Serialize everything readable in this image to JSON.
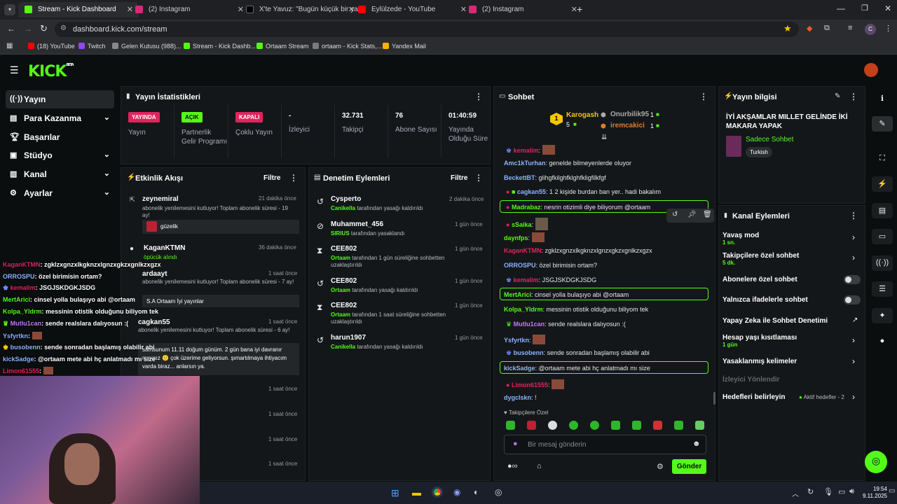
{
  "browser": {
    "tabs": [
      {
        "label": "Stream - Kick Dashboard",
        "color": "#53fc18"
      },
      {
        "label": "(2) Instagram",
        "color": "#d62976"
      },
      {
        "label": "X'te Yavuz: \"Bugün küçük bir ya",
        "color": "#111111"
      },
      {
        "label": "Eylülzede - YouTube",
        "color": "#ff0000"
      },
      {
        "label": "(2) Instagram",
        "color": "#d62976"
      }
    ],
    "url": "dashboard.kick.com/stream",
    "bookmarks": [
      "(18) YouTube",
      "Twitch",
      "Gelen Kutusu (988)...",
      "Stream - Kick Dashb...",
      "Ortaam Stream",
      "ortaam - Kick Stats,...",
      "Yandex Mail"
    ]
  },
  "kick": {
    "logo": "KICK",
    "beta": "BETA"
  },
  "sidebar": [
    {
      "label": "Yayın",
      "icon": "broadcast-icon"
    },
    {
      "label": "Para Kazanma",
      "icon": "money-icon"
    },
    {
      "label": "Başarılar",
      "icon": "trophy-icon"
    },
    {
      "label": "Stüdyo",
      "icon": "studio-icon"
    },
    {
      "label": "Kanal",
      "icon": "channel-icon"
    },
    {
      "label": "Ayarlar",
      "icon": "gear-icon"
    }
  ],
  "stats": {
    "title": "Yayın İstatistikleri",
    "items": [
      {
        "badge": "YAYINDA",
        "label": "Yayın",
        "badge_color": "#e0245e"
      },
      {
        "badge": "AÇIK",
        "label": "Partnerlik Gelir Programı",
        "badge_color": "#53fc18"
      },
      {
        "badge": "KAPALI",
        "label": "Çoklu Yayın",
        "badge_color": "#e0245e"
      },
      {
        "value": "-",
        "label": "İzleyici"
      },
      {
        "value": "32.731",
        "label": "Takipçi"
      },
      {
        "value": "76",
        "label": "Abone Sayısı"
      },
      {
        "value": "01:40:59",
        "label": "Yayında Olduğu Süre"
      }
    ]
  },
  "activity": {
    "title": "Etkinlik Akışı",
    "filter": "Filtre",
    "items": [
      {
        "user": "zeynemiral",
        "time": "21 dakika önce",
        "text": "abonelik yenilemesini kutluyor! Toplam abonelik süresi - 19 ay!",
        "msg": "güzelik"
      },
      {
        "user": "KaganKTMN",
        "time": "36 dakika önce",
        "text": "öpücük alındı",
        "msg": ""
      },
      {
        "user": "ardaayt",
        "time": "1 saat önce",
        "text": "abonelik yenilemesini kutluyor! Toplam abonelik süresi - 7 ay!",
        "msg": "S.A Ortaam İyi yayınlar"
      },
      {
        "user": "cagkan55",
        "time": "1 saat önce",
        "text": "abonelik yenilemesini kutluyor! Toplam abonelik süresi - 6 ay!",
        "msg": "samsunum 11.11 doğum günüm. 2 gün bana iyi davranır mısınız 🙂 çok üzerime geliyorsun. şımartılmaya ihtiyacım varda biraz... anlarsın ya."
      }
    ],
    "times_extra": [
      "1 saat önce",
      "1 saat önce",
      "1 saat önce",
      "1 saat önce"
    ]
  },
  "moderation": {
    "title": "Denetim Eylemleri",
    "filter": "Filtre",
    "items": [
      {
        "user": "Cysperto",
        "time": "2 dakika önce",
        "actor": "Canikella",
        "text": "tarafından yasağı kaldırıldı"
      },
      {
        "user": "Muhammet_456",
        "time": "1 gün önce",
        "actor": "SIRIUS",
        "text": "tarafından yasaklandı"
      },
      {
        "user": "CEE802",
        "time": "1 gün önce",
        "actor": "Ortaam",
        "text": "tarafından 1 gün süreliğine sohbetten uzaklaştırıldı"
      },
      {
        "user": "CEE802",
        "time": "1 gün önce",
        "actor": "Ortaam",
        "text": "tarafından yasağı kaldırıldı"
      },
      {
        "user": "CEE802",
        "time": "1 gün önce",
        "actor": "Ortaam",
        "text": "tarafından 1 saat süreliğine sohbetten uzaklaştırıldı"
      },
      {
        "user": "harun1907",
        "time": "1 gün önce",
        "actor": "Canikella",
        "text": "tarafından yasağı kaldırıldı"
      }
    ]
  },
  "chat": {
    "title": "Sohbet",
    "leader": {
      "name": "Karogash",
      "count": "5",
      "rank": "1"
    },
    "top": [
      {
        "name": "Onurbilik95",
        "count": "1"
      },
      {
        "name": "iremcakici",
        "count": "1"
      }
    ],
    "messages": [
      {
        "user": "kemalim",
        "text": "",
        "color": "#e0245e"
      },
      {
        "user": "Amc1kTurhan",
        "text": "genelde bilmeyenlerde oluyor",
        "color": "#8ab4ff"
      },
      {
        "user": "BeckettBT",
        "text": "glihgfkilghfklghfkligfilkfgf",
        "color": "#8ab4ff"
      },
      {
        "user": "cagkan55",
        "text": "1 2 kişide burdan ban yer.. hadi bakalım",
        "color": "#8ab4ff"
      },
      {
        "user": "Madrabaz",
        "text": "nesrin otizimli diye biliyorum @ortaam",
        "color": "#53fc18"
      },
      {
        "user": "sSaika",
        "text": "",
        "color": "#53fc18"
      },
      {
        "user": "daynfps",
        "text": "",
        "color": "#53fc18"
      },
      {
        "user": "KaganKTMN",
        "text": "zgklzxgnzxlkgknzxlgnzxgkzxgnlkzxgzx",
        "color": "#e0245e"
      },
      {
        "user": "ORROSPU",
        "text": "özel birimisin ortam?",
        "color": "#8ab4ff"
      },
      {
        "user": "kemalim",
        "text": "JSGJSKDGKJSDG",
        "color": "#e0245e"
      },
      {
        "user": "MertArici",
        "text": "cinsel yolla bulaşıyo abi @ortaam",
        "color": "#53fc18"
      },
      {
        "user": "Kolpa_Yldrm",
        "text": "messinin otistik olduğunu biliyom tek",
        "color": "#53fc18"
      },
      {
        "user": "Mutlu1can",
        "text": "sende realslara dalıyosun :(",
        "color": "#c17aff"
      },
      {
        "user": "Ysfyrtkn",
        "text": "",
        "color": "#8ab4ff"
      },
      {
        "user": "busobenn",
        "text": "sende sonradan başlamış olabilir abi",
        "color": "#8ab4ff"
      },
      {
        "user": "kickSadge",
        "text": "@ortaam mete abi hç anlatmadı mı size",
        "color": "#8ab4ff"
      },
      {
        "user": "Limon61555",
        "text": "",
        "color": "#e0245e"
      },
      {
        "user": "dygclskn",
        "text": "!",
        "color": "#8ab4ff"
      }
    ],
    "mode": "Takipçilere Özel",
    "placeholder": "Bir mesaj gönderin",
    "send": "Gönder"
  },
  "overlay_chat": [
    {
      "user": "KaganKTMN",
      "text": "zgklzxgnzxlkgknzxlgnzxgkzxgnlkzxgzx",
      "color": "#e0245e"
    },
    {
      "user": "ORROSPU",
      "text": "özel birimisin ortam?",
      "color": "#8ab4ff"
    },
    {
      "user": "kemalim",
      "text": "JSGJSKDGKJSDG",
      "color": "#e0245e"
    },
    {
      "user": "MertArici",
      "text": "cinsel yolla bulaşıyo abi @ortaam",
      "color": "#53fc18"
    },
    {
      "user": "Kolpa_Yldrm",
      "text": "messinin otistik olduğunu biliyom tek",
      "color": "#53fc18"
    },
    {
      "user": "Mutlu1can",
      "text": "sende realslara dalıyosun :(",
      "color": "#c17aff"
    },
    {
      "user": "Ysfyrtkn",
      "text": "",
      "color": "#8ab4ff"
    },
    {
      "user": "busobenn",
      "text": "sende sonradan başlamış olabilir abi",
      "color": "#8ab4ff"
    },
    {
      "user": "kickSadge",
      "text": "@ortaam mete abi hç anlatmadı mı size",
      "color": "#8ab4ff"
    },
    {
      "user": "Limon61555",
      "text": "",
      "color": "#e0245e"
    }
  ],
  "info": {
    "title": "Yayın bilgisi",
    "stream_title": "İYİ AKŞAMLAR MILLET GELİNDE İKİ MAKARA YAPAK",
    "category": "Sadece Sohbet",
    "tag": "Turkish"
  },
  "channel_actions": {
    "title": "Kanal Eylemleri",
    "items": [
      {
        "label": "Yavaş mod",
        "sub": "1 sn."
      },
      {
        "label": "Takipçilere özel sohbet",
        "sub": "5 dk."
      },
      {
        "label": "Abonelere özel sohbet",
        "sub": ""
      },
      {
        "label": "Yalnızca ifadelerle sohbet",
        "sub": ""
      },
      {
        "label": "Yapay Zeka ile Sohbet Denetimi",
        "sub": ""
      },
      {
        "label": "Hesap yaşı kısıtlaması",
        "sub": "1 gün"
      },
      {
        "label": "Yasaklanmış kelimeler",
        "sub": ""
      },
      {
        "label": "İzleyici Yönlendir",
        "sub": ""
      },
      {
        "label": "Hedefleri belirleyin",
        "sub": ""
      }
    ],
    "goal_status": "Aktif hedefler - 2"
  },
  "taskbar": {
    "time": "19:54",
    "date": "9.11.2025"
  }
}
